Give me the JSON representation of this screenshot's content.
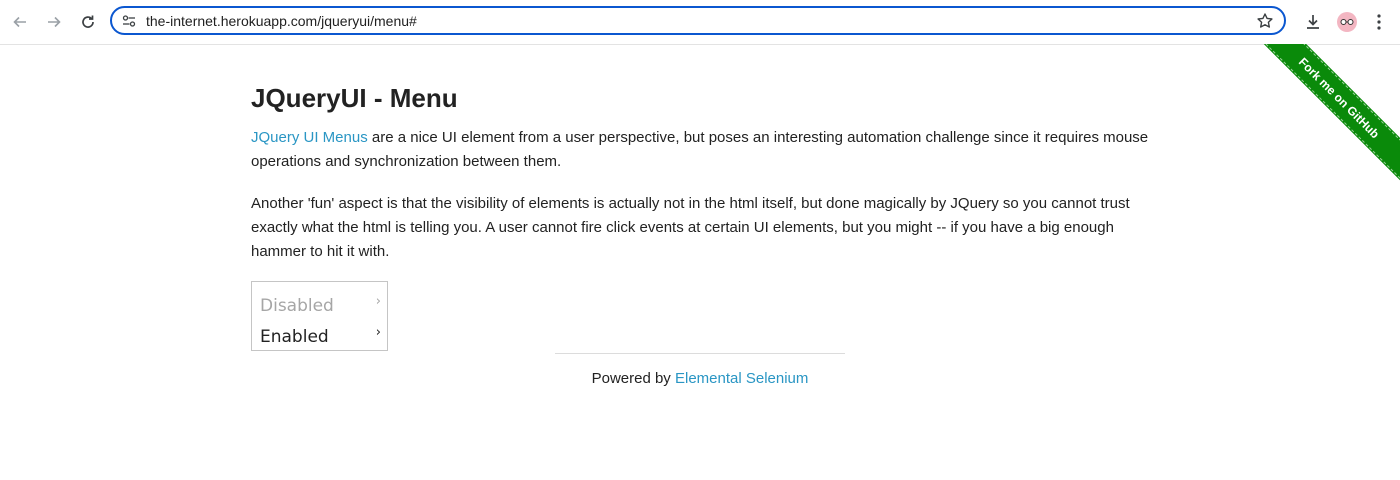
{
  "browser": {
    "url": "the-internet.herokuapp.com/jqueryui/menu#",
    "icons": [
      "back-arrow-icon",
      "forward-arrow-icon",
      "reload-icon",
      "site-settings-icon",
      "bookmark-star-icon",
      "download-icon",
      "profile-avatar-icon",
      "more-menu-icon"
    ],
    "accent": "#0b57d0"
  },
  "ribbon": {
    "text": "Fork me on GitHub",
    "color": "#0a8a0a"
  },
  "page": {
    "title": "JQueryUI - Menu",
    "intro_link": "JQuery UI Menus",
    "intro_rest": " are a nice UI element from a user perspective, but poses an interesting automation challenge since it requires mouse operations and synchronization between them.",
    "paragraph2": "Another 'fun' aspect is that the visibility of elements is actually not in the html itself, but done magically by JQuery so you cannot trust exactly what the html is telling you. A user cannot fire click events at certain UI elements, but you might -- if you have a big enough hammer to hit it with.",
    "link_color": "#2a96c4"
  },
  "menu": {
    "items": [
      {
        "label": "Disabled",
        "caret": "›",
        "state": "disabled"
      },
      {
        "label": "Enabled",
        "caret": "›",
        "state": "enabled"
      }
    ]
  },
  "footer": {
    "prefix": "Powered by ",
    "link": "Elemental Selenium"
  }
}
